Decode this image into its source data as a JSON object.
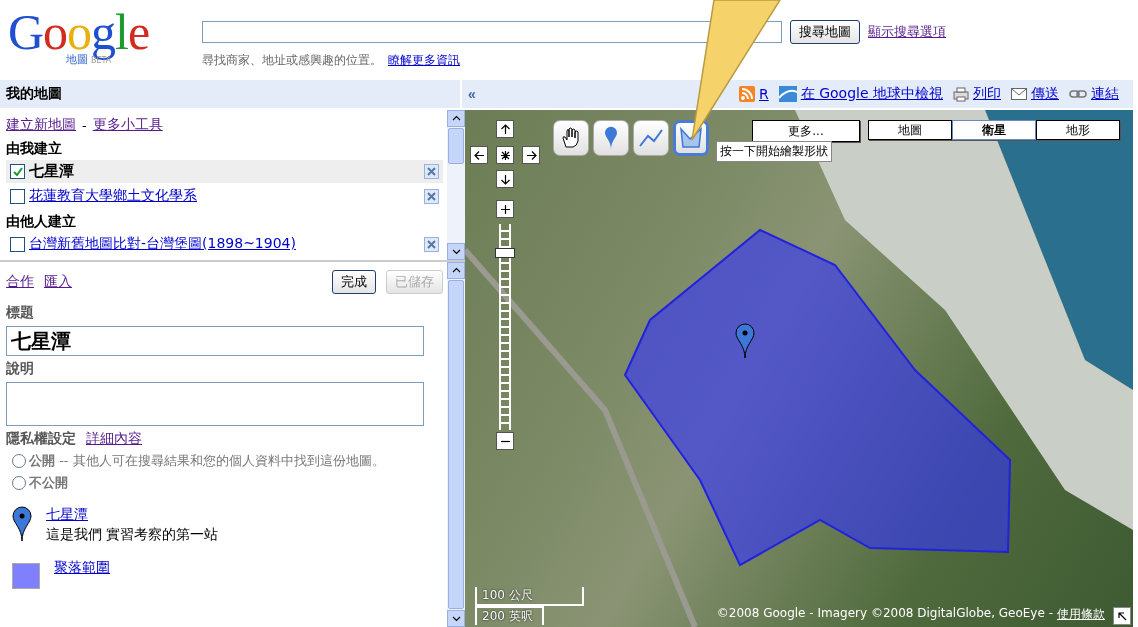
{
  "header": {
    "logo": {
      "word": "Google",
      "sub": "地圖",
      "badge": "BETA"
    },
    "search_button": "搜尋地圖",
    "options_link": "顯示搜尋選項",
    "hint": "尋找商家、地址或感興趣的位置。",
    "hint_link": "瞭解更多資訊"
  },
  "toolbar": {
    "title": "我的地圖",
    "collapse": "«",
    "links": [
      {
        "kind": "rss",
        "label": "R"
      },
      {
        "kind": "earth",
        "label": "在 Google 地球中檢視"
      },
      {
        "kind": "print",
        "label": "列印"
      },
      {
        "kind": "mail",
        "label": "傳送"
      },
      {
        "kind": "link",
        "label": "連結"
      }
    ]
  },
  "my_maps": {
    "links": [
      "建立新地圖",
      "更多小工具"
    ],
    "separator": "-",
    "sections": [
      {
        "heading": "由我建立",
        "items": [
          {
            "label": "七星潭",
            "checked": true,
            "selected": true
          },
          {
            "label": "花蓮教育大學鄉土文化學系",
            "checked": false,
            "selected": false
          }
        ]
      },
      {
        "heading": "由他人建立",
        "items": [
          {
            "label": "台灣新舊地圖比對-台灣堡圖(1898~1904)",
            "checked": false,
            "selected": false
          }
        ]
      }
    ]
  },
  "editor": {
    "links": [
      "合作",
      "匯入"
    ],
    "buttons": [
      {
        "label": "完成",
        "disabled": false
      },
      {
        "label": "已儲存",
        "disabled": true
      }
    ],
    "title_label": "標題",
    "title_value": "七星潭",
    "description_label": "說明",
    "privacy_label": "隱私權設定",
    "privacy_link": "詳細內容",
    "privacy_options": [
      {
        "label": "公開",
        "note": "-- 其他人可在搜尋結果和您的個人資料中找到這份地圖。",
        "selected": false
      },
      {
        "label": "不公開",
        "selected": false
      }
    ],
    "features": [
      {
        "kind": "marker",
        "title": "七星潭",
        "description": "這是我們 實習考察的第一站"
      },
      {
        "kind": "shape",
        "title": "聚落範圍",
        "color": "#8080ff"
      }
    ]
  },
  "map": {
    "tools": [
      {
        "kind": "hand",
        "selected": false
      },
      {
        "kind": "marker",
        "selected": false
      },
      {
        "kind": "line",
        "selected": false
      },
      {
        "kind": "shape",
        "selected": true
      }
    ],
    "tooltip": "按一下開始繪製形狀",
    "more_button": "更多...",
    "map_types": [
      {
        "label": "地圖",
        "selected": false
      },
      {
        "label": "衛星",
        "selected": true
      },
      {
        "label": "地形",
        "selected": false
      }
    ],
    "zoom": {
      "level": 0.88
    },
    "scale": [
      "100 公尺",
      "200 英呎"
    ],
    "copyright": "©2008 Google - Imagery ©2008 DigitalGlobe, GeoEye -",
    "terms": "使用條款"
  }
}
